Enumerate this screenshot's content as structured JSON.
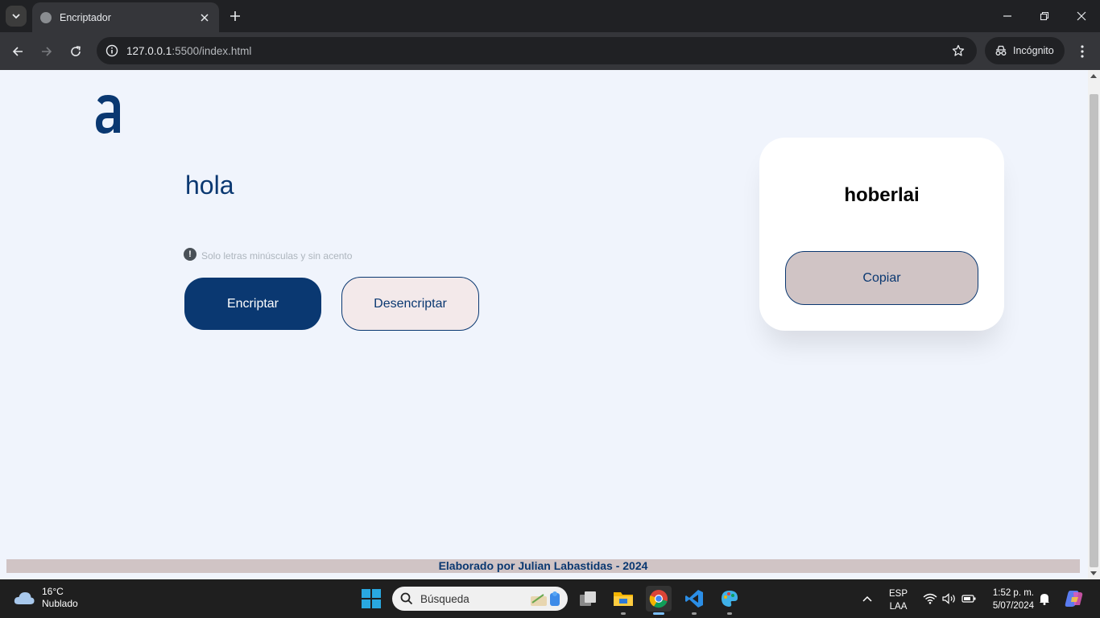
{
  "browser": {
    "tab_title": "Encriptador",
    "url_host": "127.0.0.1",
    "url_rest": ":5500/index.html",
    "incognito_label": "Incógnito"
  },
  "page": {
    "logo_letter": "a",
    "input_text": "hola",
    "hint_icon": "!",
    "hint_text": "Solo letras minúsculas y sin acento",
    "encrypt_label": "Encriptar",
    "decrypt_label": "Desencriptar",
    "result_text": "hoberlai",
    "copy_label": "Copiar",
    "footer_text": "Elaborado por Julian Labastidas - 2024",
    "colors": {
      "primary": "#0a3871",
      "background": "#f0f4fc",
      "copy_bg": "#d0c4c5",
      "decrypt_bg": "#f3e9ea"
    }
  },
  "taskbar": {
    "weather_temp": "16°C",
    "weather_desc": "Nublado",
    "search_placeholder": "Búsqueda",
    "lang_top": "ESP",
    "lang_bottom": "LAA",
    "time": "1:52 p. m.",
    "date": "5/07/2024"
  }
}
